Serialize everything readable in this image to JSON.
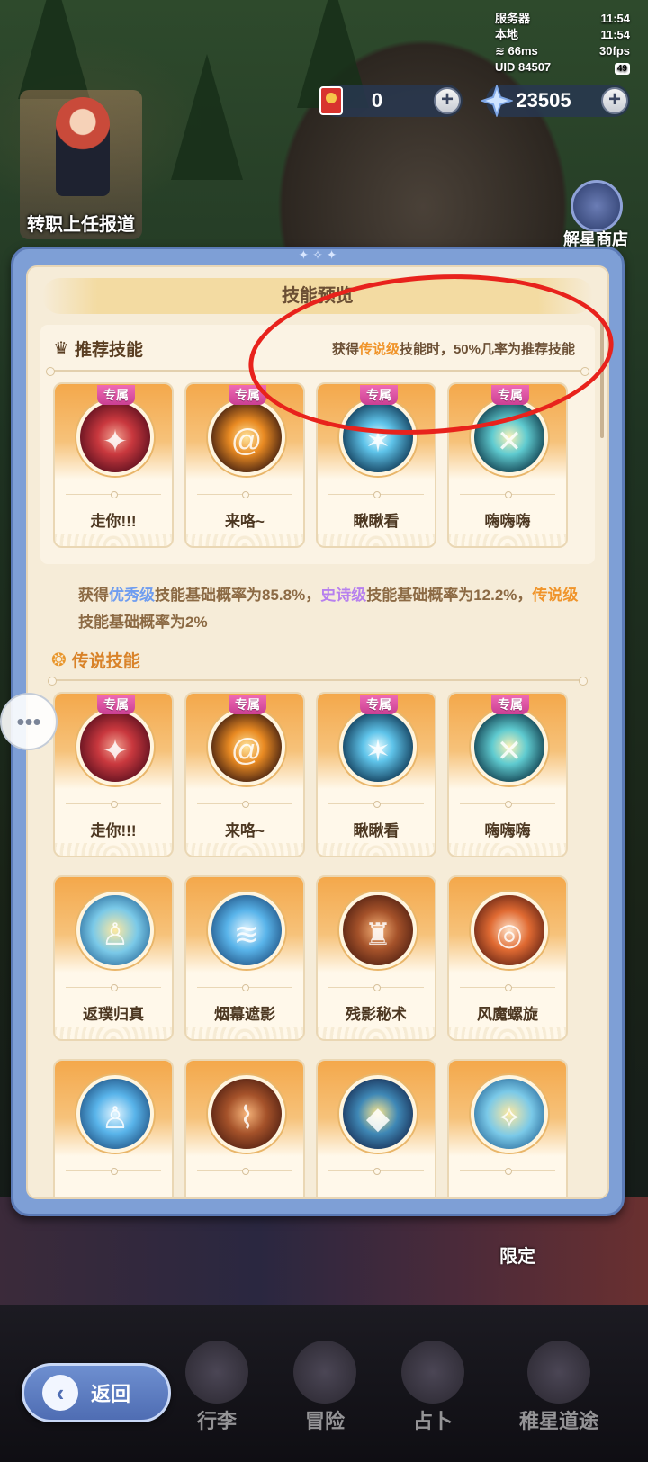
{
  "status": {
    "server_label": "服务器",
    "server_time": "11:54",
    "local_label": "本地",
    "local_time": "11:54",
    "ping": "66ms",
    "fps": "30fps",
    "uid": "UID 84507",
    "battery": "49"
  },
  "currency": [
    {
      "value": "0",
      "icon": "red-envelope-icon"
    },
    {
      "value": "23505",
      "icon": "star-crystal-icon"
    }
  ],
  "side": {
    "job_report": "转职上任报道",
    "star_shop": "解星商店"
  },
  "panel": {
    "title": "技能预览",
    "recommended": {
      "heading": "推荐技能",
      "note_prefix": "获得",
      "note_highlight": "传说级",
      "note_suffix": "技能时，50%几率为推荐技能",
      "cards": [
        {
          "badge": "专属",
          "name": "走你!!!",
          "orb": "o-red",
          "glyph": "✦"
        },
        {
          "badge": "专属",
          "name": "来咯~",
          "orb": "o-gold",
          "glyph": "@"
        },
        {
          "badge": "专属",
          "name": "瞅瞅看",
          "orb": "o-ice",
          "glyph": "✶"
        },
        {
          "badge": "专属",
          "name": "嗨嗨嗨",
          "orb": "o-teal",
          "glyph": "✕"
        }
      ]
    },
    "rates": {
      "p1": "获得",
      "rare": "优秀级",
      "p2": "技能基础概率为85.8%，",
      "epic": "史诗级",
      "p3": "技能基础概率为12.2%，",
      "legend": "传说级",
      "p4": "技能基础概率为2%"
    },
    "legendary": {
      "heading": "传说技能",
      "row1": [
        {
          "badge": "专属",
          "name": "走你!!!",
          "orb": "o-red",
          "glyph": "✦"
        },
        {
          "badge": "专属",
          "name": "来咯~",
          "orb": "o-gold",
          "glyph": "@"
        },
        {
          "badge": "专属",
          "name": "瞅瞅看",
          "orb": "o-ice",
          "glyph": "✶"
        },
        {
          "badge": "专属",
          "name": "嗨嗨嗨",
          "orb": "o-teal",
          "glyph": "✕"
        }
      ],
      "row2": [
        {
          "name": "返璞归真",
          "orb": "o-sky",
          "glyph": "♙"
        },
        {
          "name": "烟幕遮影",
          "orb": "o-blue",
          "glyph": "≋"
        },
        {
          "name": "残影秘术",
          "orb": "o-brown",
          "glyph": "♜"
        },
        {
          "name": "风魔螺旋",
          "orb": "o-fire",
          "glyph": "◎"
        }
      ],
      "row3": [
        {
          "name": "",
          "orb": "o-blue",
          "glyph": "♙"
        },
        {
          "name": "",
          "orb": "o-brown",
          "glyph": "⌇"
        },
        {
          "name": "",
          "orb": "o-purple",
          "glyph": "◆"
        },
        {
          "name": "",
          "orb": "o-sky",
          "glyph": "✧"
        }
      ]
    }
  },
  "banner": {
    "limited": "限定"
  },
  "nav": {
    "back": "返回",
    "items": [
      "行李",
      "冒险",
      "占卜",
      "稚星道途"
    ]
  }
}
